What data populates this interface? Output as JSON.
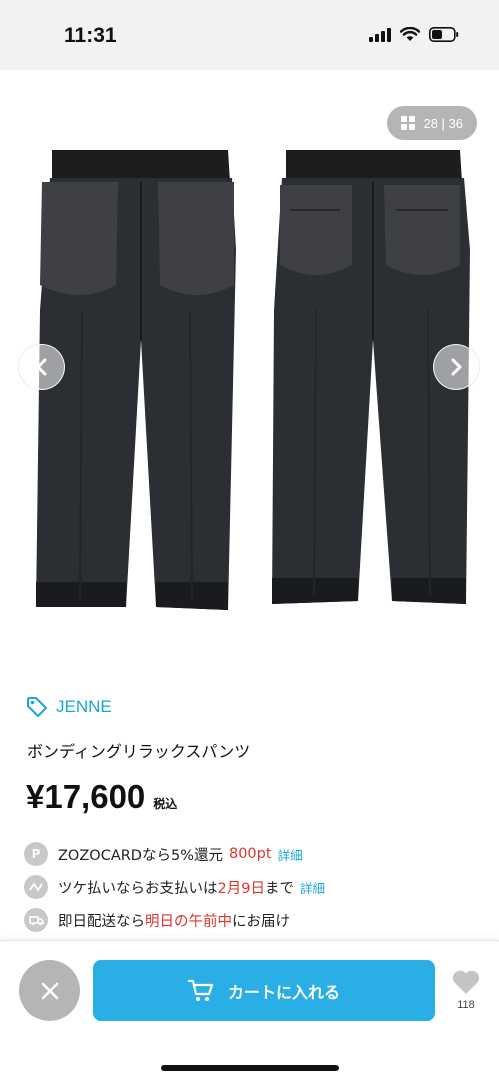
{
  "status_bar": {
    "time": "11:31"
  },
  "gallery": {
    "counter": "28 | 36",
    "prev_icon": "chevron-left-icon",
    "next_icon": "chevron-right-icon"
  },
  "product": {
    "brand": "JENNE",
    "title": "ボンディングリラックスパンツ",
    "price": "¥17,600",
    "tax_label": "税込"
  },
  "info": {
    "zozocard": {
      "icon_letter": "P",
      "text": "ZOZOCARDなら5%還元",
      "points": "800pt",
      "link": "詳細"
    },
    "tsuke": {
      "text_a": "ツケ払いならお支払いは",
      "date": "2月9日",
      "text_b": "まで",
      "link": "詳細"
    },
    "delivery": {
      "text_a": "即日配送なら",
      "highlight": "明日の午前中",
      "text_b": "にお届け"
    }
  },
  "bottom_bar": {
    "cart_label": "カートに入れる",
    "favorite_count": "118"
  },
  "colors": {
    "accent": "#29aee6",
    "brand": "#1aa6d6",
    "highlight_red": "#e0342b"
  }
}
